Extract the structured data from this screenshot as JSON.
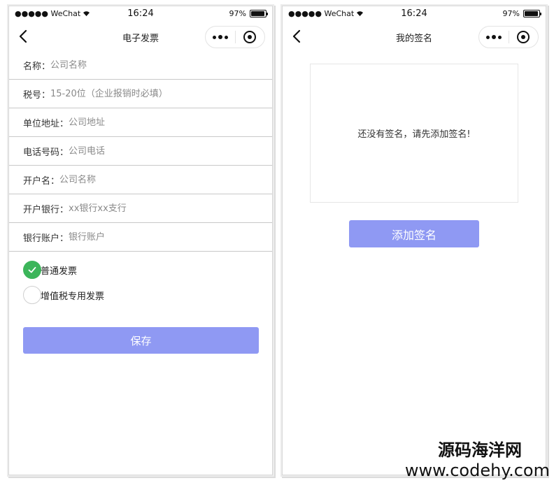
{
  "left_screen": {
    "status": {
      "carrier": "●●●●● WeChat",
      "time": "16:24",
      "battery": "97%",
      "battery_level": 0.97
    },
    "nav": {
      "title": "电子发票"
    },
    "form": {
      "fields": [
        {
          "label": "名称：",
          "placeholder": "公司名称"
        },
        {
          "label": "税号：",
          "placeholder": "15-20位（企业报销时必填）"
        },
        {
          "label": "单位地址：",
          "placeholder": "公司地址"
        },
        {
          "label": "电话号码：",
          "placeholder": "公司电话"
        },
        {
          "label": "开户名：",
          "placeholder": "公司名称"
        },
        {
          "label": "开户银行：",
          "placeholder": "xx银行xx支行"
        },
        {
          "label": "银行账户：",
          "placeholder": "银行账户"
        }
      ],
      "invoice_types": [
        {
          "label": "普通发票",
          "checked": true
        },
        {
          "label": "增值税专用发票",
          "checked": false
        }
      ],
      "save_label": "保存"
    }
  },
  "right_screen": {
    "status": {
      "carrier": "●●●●● WeChat",
      "time": "16:24",
      "battery": "97%",
      "battery_level": 0.97
    },
    "nav": {
      "title": "我的签名"
    },
    "signature": {
      "empty_text": "还没有签名，请先添加签名!",
      "add_label": "添加签名"
    }
  },
  "watermark": {
    "name": "源码海洋网",
    "url": "www.codehy.com"
  },
  "colors": {
    "accent": "#8f99f3",
    "check": "#3cb55a"
  }
}
